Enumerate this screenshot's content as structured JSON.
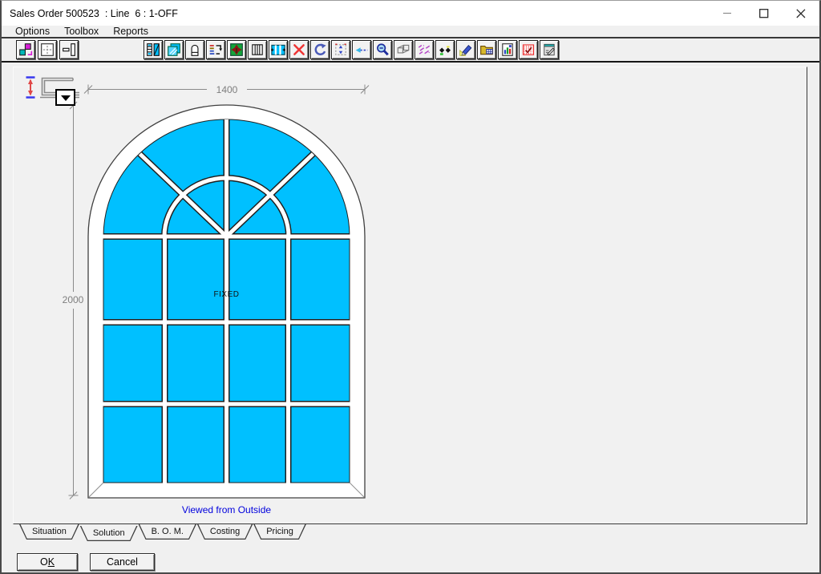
{
  "window": {
    "title": "Sales Order 500523  : Line  6 : 1-OFF",
    "controls": [
      {
        "name": "minimize",
        "icon": "minimize-icon"
      },
      {
        "name": "maximize",
        "icon": "maximize-icon"
      },
      {
        "name": "close",
        "icon": "close-icon"
      }
    ]
  },
  "menu": {
    "items": [
      "Options",
      "Toolbox",
      "Reports"
    ]
  },
  "toolbar": {
    "group1": [
      {
        "icon": "frame-cascade-icon"
      },
      {
        "icon": "frame-dimension-icon"
      },
      {
        "icon": "panel-insert-icon"
      }
    ],
    "group2": [
      {
        "icon": "frame-style-icon"
      },
      {
        "icon": "glazing-icon"
      },
      {
        "icon": "vent-lock-icon"
      },
      {
        "icon": "spec-options-icon"
      },
      {
        "icon": "hardware-icon"
      },
      {
        "icon": "louvre-icon"
      },
      {
        "icon": "georgian-bars-icon"
      },
      {
        "icon": "delete-icon"
      },
      {
        "icon": "undo-icon"
      },
      {
        "icon": "stretch-icon"
      },
      {
        "icon": "nudge-left-icon"
      },
      {
        "icon": "zoom-icon"
      },
      {
        "icon": "view-3d-icon"
      },
      {
        "icon": "sketch-icon"
      },
      {
        "icon": "dim-points-icon"
      },
      {
        "icon": "highlight-marker-icon"
      },
      {
        "icon": "component-library-icon"
      },
      {
        "icon": "report-chart-icon"
      },
      {
        "icon": "void-grid-icon"
      },
      {
        "icon": "memo-notes-icon"
      }
    ]
  },
  "designer": {
    "profile_dropdown_icon": "dropdown-arrow-icon",
    "dimensions": {
      "width": "1400",
      "height": "2000"
    },
    "pane_label": "FIXED",
    "caption": "Viewed from Outside",
    "colors": {
      "glass": "#00c0ff",
      "frame": "#ffffff",
      "caption": "#0000dd",
      "dimension": "#7e7e7e"
    }
  },
  "tabs": {
    "items": [
      "Situation",
      "Solution",
      "B. O. M.",
      "Costing",
      "Pricing"
    ],
    "active": "Solution"
  },
  "actions": {
    "ok_pre": "O",
    "ok_key": "K",
    "cancel": "Cancel"
  }
}
